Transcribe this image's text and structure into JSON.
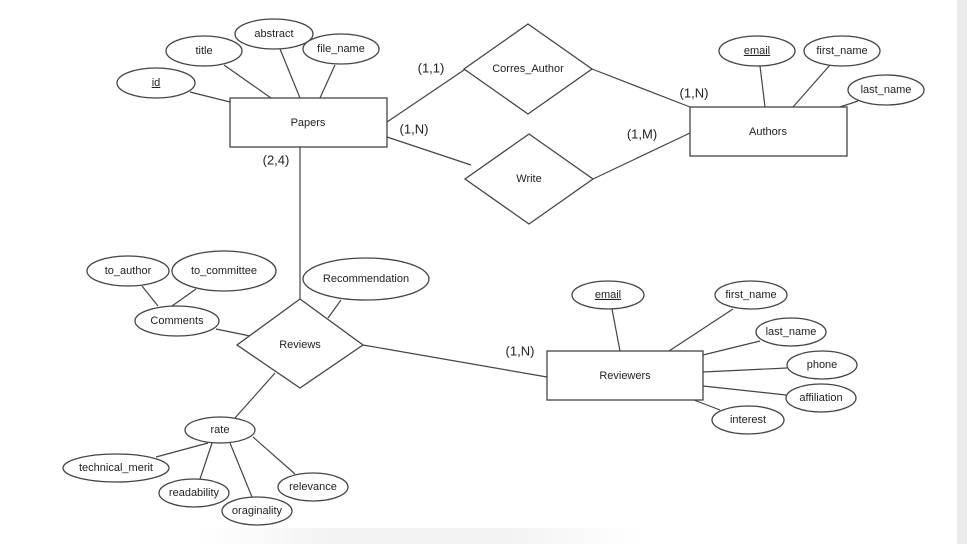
{
  "entities": {
    "papers": {
      "name": "Papers",
      "attributes": {
        "id": "id",
        "title": "title",
        "abstract": "abstract",
        "file_name": "file_name"
      },
      "key": "id"
    },
    "authors": {
      "name": "Authors",
      "attributes": {
        "email": "email",
        "first_name": "first_name",
        "last_name": "last_name"
      },
      "key": "email"
    },
    "reviewers": {
      "name": "Reviewers",
      "attributes": {
        "email": "email",
        "first_name": "first_name",
        "last_name": "last_name",
        "phone": "phone",
        "affiliation": "affiliation",
        "interest": "interest"
      },
      "key": "email"
    }
  },
  "relationships": {
    "corres_author": {
      "name": "Corres_Author",
      "papers_card": "(1,1)",
      "authors_card": "(1,N)"
    },
    "write": {
      "name": "Write",
      "papers_card": "(1,N)",
      "authors_card": "(1,M)"
    },
    "reviews": {
      "name": "Reviews",
      "papers_card": "(2,4)",
      "reviewers_card": "(1,N)",
      "attributes": {
        "recommendation": "Recommendation",
        "comments": "Comments",
        "to_author": "to_author",
        "to_committee": "to_committee",
        "rate": "rate",
        "technical_merit": "technical_merit",
        "readability": "readability",
        "oraginality": "oraginality",
        "relevance": "relevance"
      }
    }
  },
  "colors": {
    "stroke": "#444444",
    "background": "#ffffff",
    "scrollbar": "#ebebeb"
  }
}
